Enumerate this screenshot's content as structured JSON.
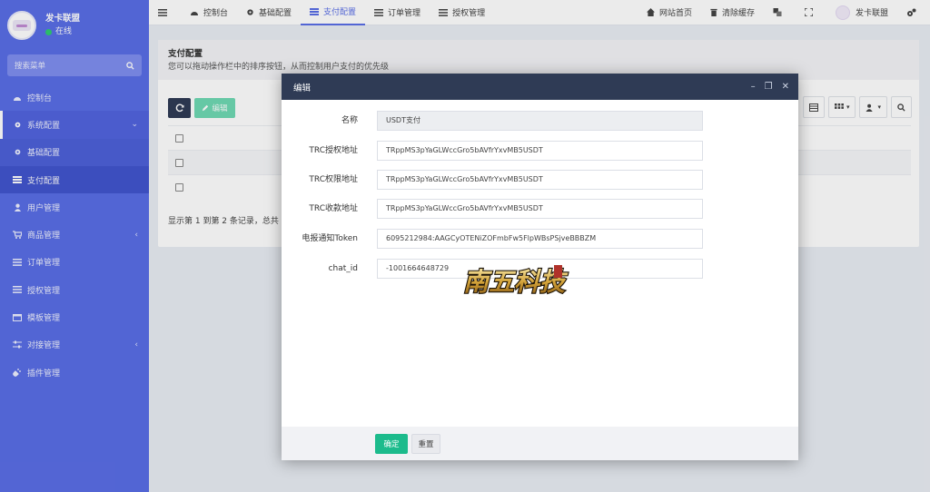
{
  "sidebar": {
    "user_name": "发卡联盟",
    "user_status": "在线",
    "search_placeholder": "搜索菜单",
    "items": [
      {
        "label": "控制台",
        "icon": "dashboard-icon"
      },
      {
        "label": "系统配置",
        "icon": "gear-icon"
      },
      {
        "label": "基础配置",
        "icon": "gear-icon"
      },
      {
        "label": "支付配置",
        "icon": "list-icon"
      },
      {
        "label": "用户管理",
        "icon": "user-icon"
      },
      {
        "label": "商品管理",
        "icon": "cart-icon"
      },
      {
        "label": "订单管理",
        "icon": "list-icon"
      },
      {
        "label": "授权管理",
        "icon": "list-icon"
      },
      {
        "label": "模板管理",
        "icon": "template-icon"
      },
      {
        "label": "对接管理",
        "icon": "sliders-icon"
      },
      {
        "label": "插件管理",
        "icon": "plug-icon"
      }
    ]
  },
  "topbar": {
    "tabs": [
      {
        "label": "控制台",
        "icon": "dashboard-icon"
      },
      {
        "label": "基础配置",
        "icon": "gear-icon"
      },
      {
        "label": "支付配置",
        "icon": "list-icon"
      },
      {
        "label": "订单管理",
        "icon": "list-icon"
      },
      {
        "label": "授权管理",
        "icon": "list-icon"
      }
    ],
    "site_home": "网站首页",
    "clear_cache": "清除缓存",
    "user_name": "发卡联盟"
  },
  "page": {
    "title": "支付配置",
    "description": "您可以拖动操作栏中的排序按钮，从而控制用户支付的优先级",
    "edit_button": "编辑",
    "pager_text": "显示第 1 到第 2 条记录，总共"
  },
  "modal": {
    "title": "编辑",
    "fields": [
      {
        "label": "名称",
        "value": "USDT支付",
        "readonly": true
      },
      {
        "label": "TRC授权地址",
        "value": "TRppMS3pYaGLWccGro5bAVfrYxvMB5USDT"
      },
      {
        "label": "TRC权限地址",
        "value": "TRppMS3pYaGLWccGro5bAVfrYxvMB5USDT"
      },
      {
        "label": "TRC收款地址",
        "value": "TRppMS3pYaGLWccGro5bAVfrYxvMB5USDT"
      },
      {
        "label": "电报通知Token",
        "value": "6095212984:AAGCyOTENiZOFmbFw5FlpWBsPSjveBBBZM"
      },
      {
        "label": "chat_id",
        "value": "-1001664648729"
      }
    ],
    "ok_button": "确定",
    "reset_button": "重置"
  },
  "watermark": {
    "text": "南五科技"
  },
  "colors": {
    "sidebar": "#5a6ee6",
    "modal_header": "#2f3b55",
    "ok": "#1cbb8c",
    "edit": "#6fd9b4"
  }
}
